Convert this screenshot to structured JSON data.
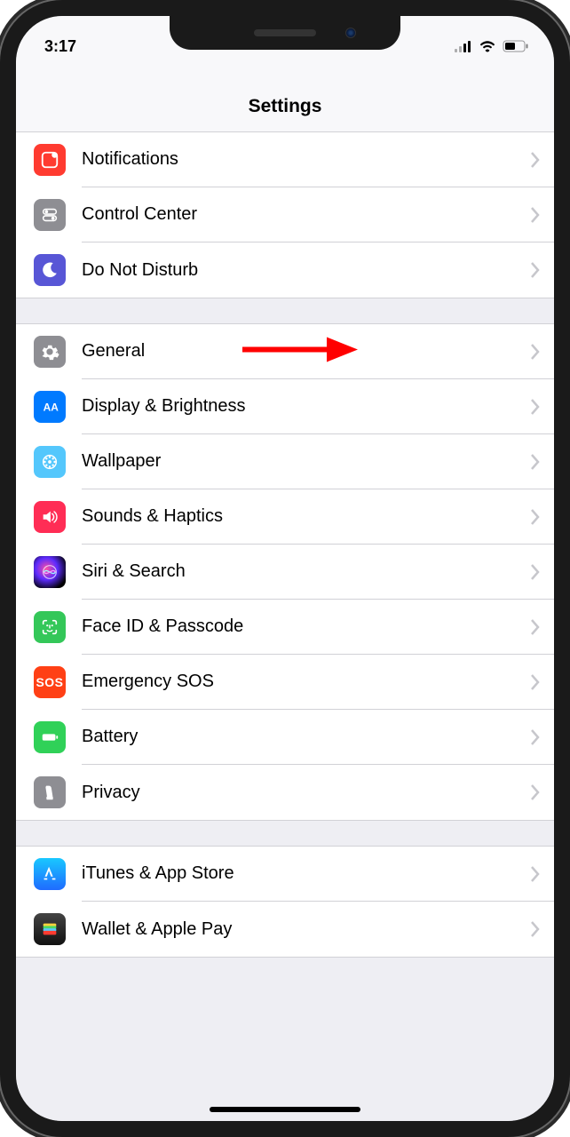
{
  "status": {
    "time": "3:17"
  },
  "header": {
    "title": "Settings"
  },
  "sections": [
    {
      "rows": [
        {
          "label": "Notifications"
        },
        {
          "label": "Control Center"
        },
        {
          "label": "Do Not Disturb"
        }
      ]
    },
    {
      "rows": [
        {
          "label": "General"
        },
        {
          "label": "Display & Brightness"
        },
        {
          "label": "Wallpaper"
        },
        {
          "label": "Sounds & Haptics"
        },
        {
          "label": "Siri & Search"
        },
        {
          "label": "Face ID & Passcode"
        },
        {
          "label": "Emergency SOS"
        },
        {
          "label": "Battery"
        },
        {
          "label": "Privacy"
        }
      ]
    },
    {
      "rows": [
        {
          "label": "iTunes & App Store"
        },
        {
          "label": "Wallet & Apple Pay"
        }
      ]
    }
  ],
  "sos_icon_text": "SOS",
  "annotation": {
    "points_to": "General"
  }
}
